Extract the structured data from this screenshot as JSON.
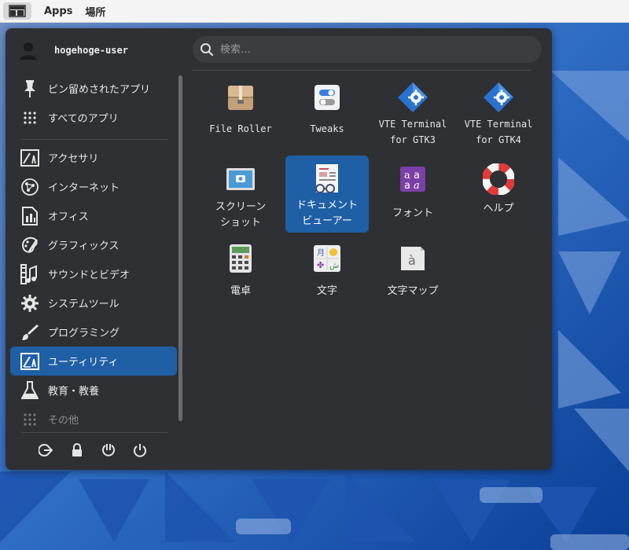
{
  "topbar": {
    "menu_apps": "Apps",
    "menu_places": "場所"
  },
  "user": {
    "name": "hogehoge-user"
  },
  "search": {
    "placeholder": "検索…"
  },
  "categories": [
    {
      "label": "ピン留めされたアプリ",
      "icon": "pin-icon"
    },
    {
      "label": "すべてのアプリ",
      "icon": "grid-icon"
    },
    {
      "label": "アクセサリ",
      "icon": "accessories-icon"
    },
    {
      "label": "インターネット",
      "icon": "internet-icon"
    },
    {
      "label": "オフィス",
      "icon": "office-icon"
    },
    {
      "label": "グラフィックス",
      "icon": "graphics-icon"
    },
    {
      "label": "サウンドとビデオ",
      "icon": "sound-video-icon"
    },
    {
      "label": "システムツール",
      "icon": "system-tools-icon"
    },
    {
      "label": "プログラミング",
      "icon": "programming-icon"
    },
    {
      "label": "ユーティリティ",
      "icon": "utilities-icon",
      "selected": true
    },
    {
      "label": "教育・教養",
      "icon": "education-icon"
    },
    {
      "label": "その他",
      "icon": "other-icon"
    }
  ],
  "apps": [
    {
      "label": "File Roller",
      "icon": "file-roller-icon"
    },
    {
      "label": "Tweaks",
      "icon": "tweaks-icon"
    },
    {
      "label": "VTE Terminal\nfor GTK3",
      "icon": "vte-terminal-gtk3-icon"
    },
    {
      "label": "VTE Terminal\nfor GTK4",
      "icon": "vte-terminal-gtk4-icon"
    },
    {
      "label": "スクリーン\nショット",
      "icon": "screenshot-icon"
    },
    {
      "label": "ドキュメント\nビューアー",
      "icon": "document-viewer-icon",
      "selected": true
    },
    {
      "label": "フォント",
      "icon": "fonts-icon"
    },
    {
      "label": "ヘルプ",
      "icon": "help-icon"
    },
    {
      "label": "電卓",
      "icon": "calculator-icon"
    },
    {
      "label": "文字",
      "icon": "characters-icon"
    },
    {
      "label": "文字マップ",
      "icon": "character-map-icon"
    }
  ],
  "session_buttons": [
    "logout-icon",
    "lock-icon",
    "suspend-icon",
    "power-icon"
  ],
  "colors": {
    "selection": "#1f5fa6",
    "panel": "#2f3033",
    "wallpaper": "#0b4fa8"
  }
}
